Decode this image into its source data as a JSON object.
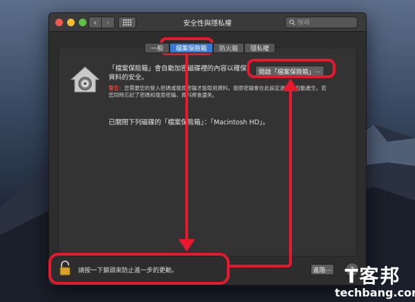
{
  "window": {
    "title": "安全性與隱私權",
    "search_placeholder": "搜尋"
  },
  "tabs": [
    {
      "label": "一般",
      "active": false
    },
    {
      "label": "檔案保險箱",
      "active": true
    },
    {
      "label": "防火牆",
      "active": false
    },
    {
      "label": "隱私權",
      "active": false
    }
  ],
  "filevault": {
    "description": "「檔案保險箱」會自動加密磁碟裡的內容以確保資料的安全。",
    "open_button_label": "開啟「檔案保險箱」⋯",
    "warning_label": "警告：",
    "warning_text": "您需要您的登入密碼或復原密鑰才能取用資料。復原密鑰會在此設定過程中自動產生。若您同時忘記了密碼和復原密鑰，資料將會遺失。",
    "status_text": "已關閉下列磁碟的「檔案保險箱」：「Macintosh HD」。"
  },
  "footer": {
    "lock_text": "請按一下鎖頭來防止進一步的更動。",
    "advanced_button_label": "進階⋯",
    "help_label": "?"
  },
  "watermark": {
    "zh": "T客邦",
    "en": "techbang.com"
  },
  "colors": {
    "accent": "#3a78d6",
    "annotation": "#e8192c",
    "warning": "#ff5d55"
  }
}
